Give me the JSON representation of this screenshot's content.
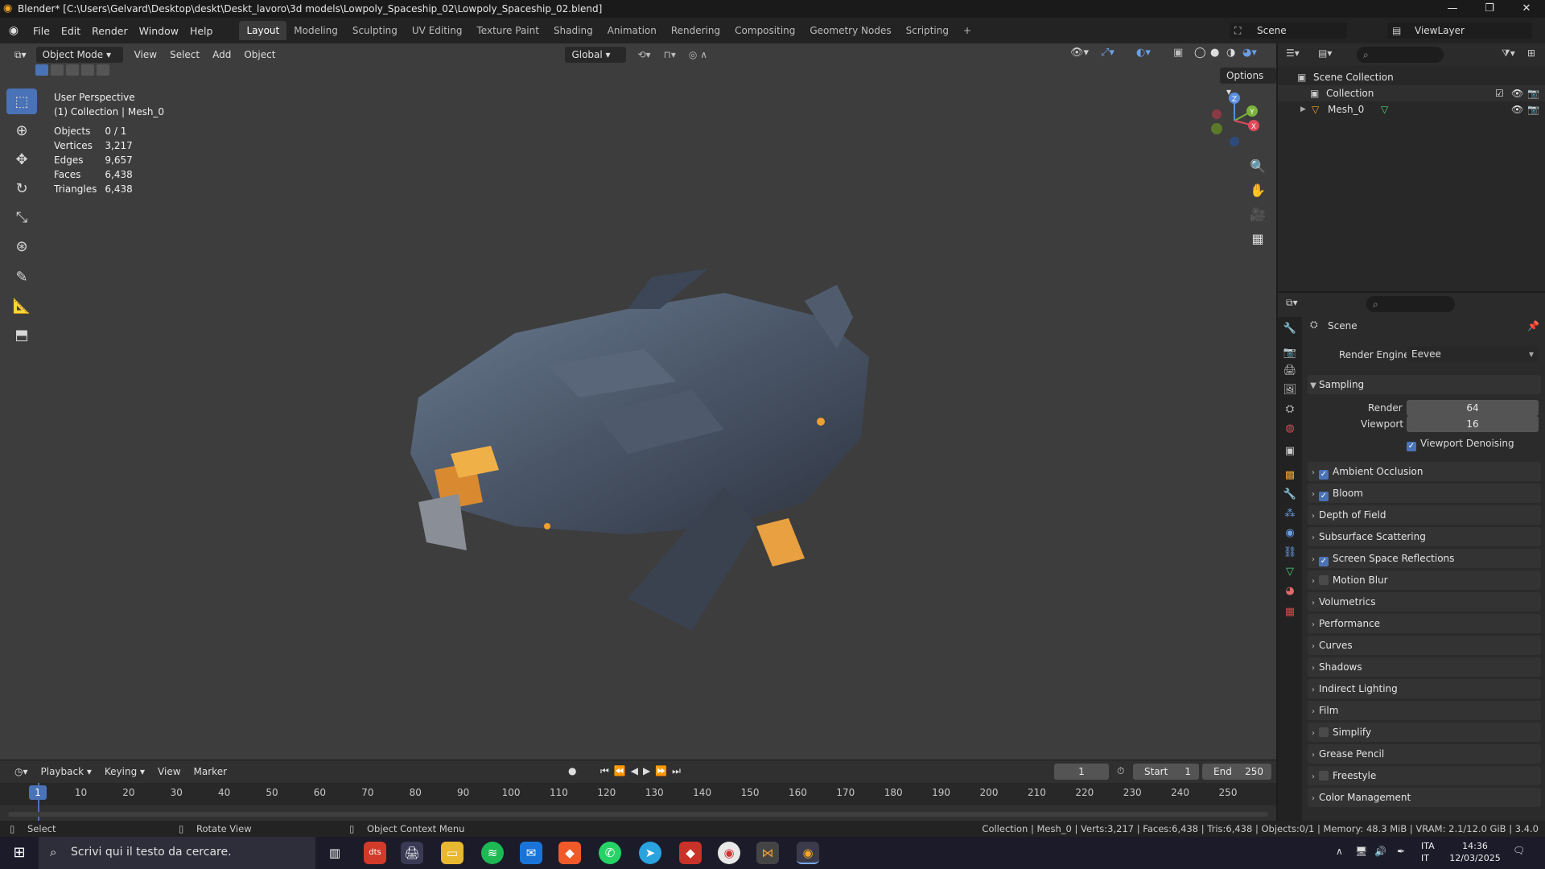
{
  "window": {
    "title": "Blender* [C:\\Users\\Gelvard\\Desktop\\deskt\\Deskt_lavoro\\3d models\\Lowpoly_Spaceship_02\\Lowpoly_Spaceship_02.blend]",
    "min": "—",
    "max": "❐",
    "close": "✕"
  },
  "menu": [
    "File",
    "Edit",
    "Render",
    "Window",
    "Help"
  ],
  "workspaces": [
    "Layout",
    "Modeling",
    "Sculpting",
    "UV Editing",
    "Texture Paint",
    "Shading",
    "Animation",
    "Rendering",
    "Compositing",
    "Geometry Nodes",
    "Scripting"
  ],
  "scene_name": "Scene",
  "view_layer": "ViewLayer",
  "viewport": {
    "mode": "Object Mode",
    "menus": [
      "View",
      "Select",
      "Add",
      "Object"
    ],
    "orientation": "Global",
    "options": "Options",
    "perspective": "User Perspective",
    "collection_line": "(1) Collection | Mesh_0",
    "stats": [
      {
        "label": "Objects",
        "value": "0 / 1"
      },
      {
        "label": "Vertices",
        "value": "3,217"
      },
      {
        "label": "Edges",
        "value": "9,657"
      },
      {
        "label": "Faces",
        "value": "6,438"
      },
      {
        "label": "Triangles",
        "value": "6,438"
      }
    ],
    "gizmo": {
      "z": "Z",
      "y": "Y",
      "x": "X"
    }
  },
  "timeline": {
    "menus": [
      "Playback",
      "Keying",
      "View",
      "Marker"
    ],
    "current_frame": "1",
    "start_label": "Start",
    "start": "1",
    "end_label": "End",
    "end": "250",
    "ticks": [
      "1",
      "10",
      "20",
      "30",
      "40",
      "50",
      "60",
      "70",
      "80",
      "90",
      "100",
      "110",
      "120",
      "130",
      "140",
      "150",
      "160",
      "170",
      "180",
      "190",
      "200",
      "210",
      "220",
      "230",
      "240",
      "250"
    ]
  },
  "status": {
    "select": "Select",
    "rotate": "Rotate View",
    "context": "Object Context Menu",
    "info": "Collection | Mesh_0 | Verts:3,217 | Faces:6,438 | Tris:6,438 | Objects:0/1 | Memory: 48.3 MiB | VRAM: 2.1/12.0 GiB | 3.4.0"
  },
  "outliner": {
    "root": "Scene Collection",
    "collection": "Collection",
    "object": "Mesh_0"
  },
  "properties": {
    "context": "Scene",
    "render_engine_label": "Render Engine",
    "render_engine": "Eevee",
    "sampling": "Sampling",
    "render_label": "Render",
    "render_samples": "64",
    "viewport_label": "Viewport",
    "viewport_samples": "16",
    "viewport_denoising": "Viewport Denoising",
    "panels": [
      {
        "label": "Ambient Occlusion",
        "checkbox": true,
        "checked": true
      },
      {
        "label": "Bloom",
        "checkbox": true,
        "checked": true
      },
      {
        "label": "Depth of Field",
        "checkbox": false,
        "checked": false
      },
      {
        "label": "Subsurface Scattering",
        "checkbox": false,
        "checked": false
      },
      {
        "label": "Screen Space Reflections",
        "checkbox": true,
        "checked": true
      },
      {
        "label": "Motion Blur",
        "checkbox": true,
        "checked": false
      },
      {
        "label": "Volumetrics",
        "checkbox": false,
        "checked": false
      },
      {
        "label": "Performance",
        "checkbox": false,
        "checked": false
      },
      {
        "label": "Curves",
        "checkbox": false,
        "checked": false
      },
      {
        "label": "Shadows",
        "checkbox": false,
        "checked": false
      },
      {
        "label": "Indirect Lighting",
        "checkbox": false,
        "checked": false
      },
      {
        "label": "Film",
        "checkbox": false,
        "checked": false
      },
      {
        "label": "Simplify",
        "checkbox": true,
        "checked": false
      },
      {
        "label": "Grease Pencil",
        "checkbox": false,
        "checked": false
      },
      {
        "label": "Freestyle",
        "checkbox": true,
        "checked": false
      },
      {
        "label": "Color Management",
        "checkbox": false,
        "checked": false
      }
    ]
  },
  "taskbar": {
    "search_placeholder": "Scrivi qui il testo da cercare.",
    "lang1": "ITA",
    "lang2": "IT",
    "time": "14:36",
    "date": "12/03/2025"
  }
}
